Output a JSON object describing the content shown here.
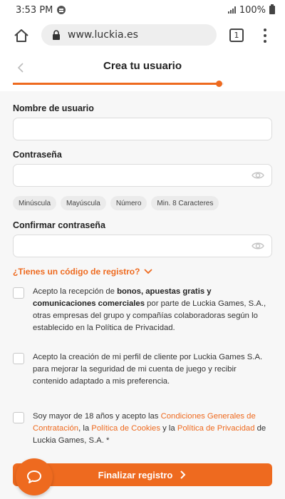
{
  "status": {
    "time": "3:53 PM",
    "battery": "100%"
  },
  "browser": {
    "url": "www.luckia.es",
    "tab_count": "1"
  },
  "header": {
    "title": "Crea tu usuario",
    "progress": 0.98
  },
  "form": {
    "username_label": "Nombre de usuario",
    "password_label": "Contraseña",
    "confirm_label": "Confirmar contraseña",
    "password_hints": [
      "Minúscula",
      "Mayúscula",
      "Número",
      "Min. 8 Caracteres"
    ],
    "promo_link": "¿Tienes un código de registro?",
    "checkboxes": [
      {
        "prefix": "Acepto la recepción de ",
        "bold": "bonos, apuestas gratis y comunicaciones comerciales",
        "suffix": " por parte de Luckia Games, S.A., otras empresas del grupo y compañías colaboradoras según lo establecido en la Política de Privacidad."
      },
      {
        "text": "Acepto la creación de mi perfil de cliente por Luckia Games S.A. para mejorar la seguridad de mi cuenta de juego y recibir contenido adaptado a mis preferencia."
      },
      {
        "p1": "Soy mayor de 18 años y acepto las ",
        "l1": "Condiciones Generales de Contratación",
        "p2": ", la ",
        "l2": "Política de Cookies",
        "p3": " y la ",
        "l3": "Política de Privacidad",
        "p4": " de Luckia Games, S.A. *"
      }
    ],
    "submit_label": "Finalizar registro"
  },
  "icons": [
    "home-icon",
    "lock-icon",
    "tab-switcher-icon",
    "kebab-menu-icon",
    "back-arrow-icon",
    "eye-icon",
    "chevron-down-icon",
    "chevron-right-icon",
    "chat-icon"
  ],
  "colors": {
    "accent": "#ee6a1f",
    "background": "#f7f7f7"
  }
}
